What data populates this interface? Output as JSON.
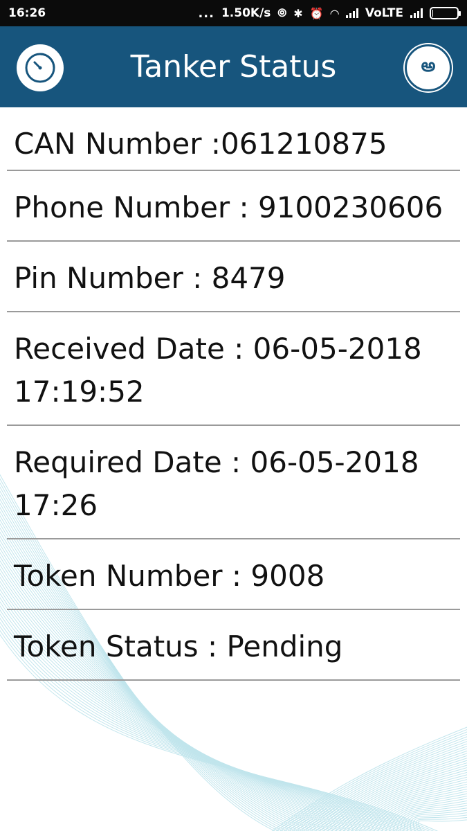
{
  "status_bar": {
    "time": "16:26",
    "dots": "...",
    "net_speed": "1.50K/s",
    "carrier": "VoLTE"
  },
  "app_bar": {
    "title": "Tanker Status",
    "left_icon": "stopwatch-icon",
    "right_icon": "telugu-language-icon",
    "right_glyph": "అ"
  },
  "details": {
    "can_number": "CAN Number :061210875",
    "phone_number": "Phone Number : 9100230606",
    "pin_number": "Pin Number : 8479",
    "received_date_line1": "Received Date : 06-05-2018",
    "received_date_line2": "17:19:52",
    "required_date_line1": "Required Date : 06-05-2018",
    "required_date_line2": "17:26",
    "token_number": "Token Number : 9008",
    "token_status": "Token Status : Pending"
  },
  "colors": {
    "app_bar": "#17557d",
    "status_bar": "#0b0b0b",
    "divider": "#9a9a9a",
    "wave": "#7fc7d6"
  }
}
